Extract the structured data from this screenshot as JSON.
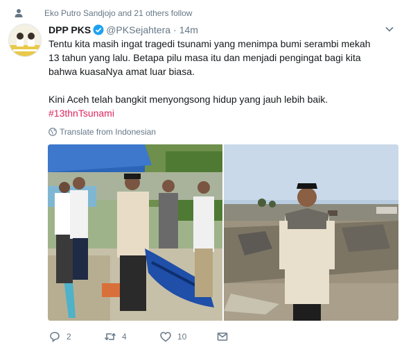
{
  "social_context": {
    "text": "Eko Putro Sandjojo and 21 others follow",
    "icon": "person-icon"
  },
  "tweet": {
    "author_name": "DPP PKS",
    "handle": "@PKSejahtera",
    "separator": "·",
    "time": "14m",
    "text_line1": "Tentu kita masih ingat tragedi tsunami yang menimpa bumi serambi mekah 13 tahun yang lalu. Betapa pilu masa itu dan menjadi pengingat bagi kita bahwa kuasaNya amat luar biasa.",
    "text_line2": "Kini Aceh telah bangkit menyongsong hidup yang jauh lebih baik.",
    "hashtag": "#13thnTsunami",
    "translate_label": "Translate from Indonesian"
  },
  "actions": {
    "reply_count": "2",
    "retweet_count": "4",
    "like_count": "10"
  },
  "colors": {
    "text": "#14171a",
    "secondary": "#657786",
    "hashtag": "#e0245e",
    "verified": "#1da1f2"
  }
}
